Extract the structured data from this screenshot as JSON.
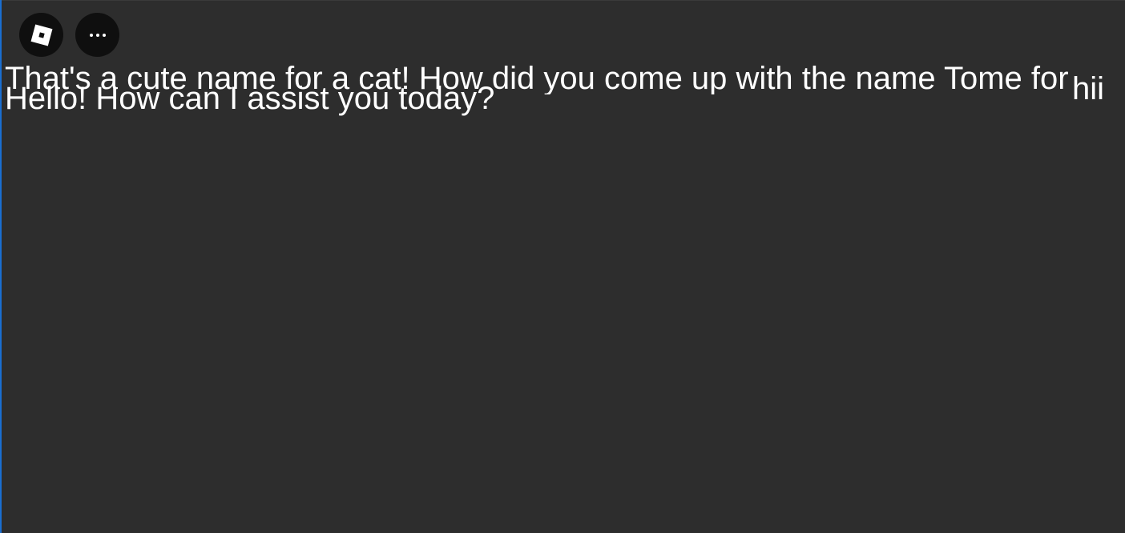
{
  "toolbar": {
    "menu_icon": "roblox-logo-icon",
    "more_icon": "more-dots-icon"
  },
  "chat": {
    "messages": [
      {
        "role": "bot",
        "text": "That's a cute name for a cat! How did you come up with the name Tome for"
      },
      {
        "role": "bot",
        "text": "Hello! How can I assist you today?"
      },
      {
        "role": "user",
        "text": "hii"
      }
    ]
  },
  "colors": {
    "background": "#2d2d2d",
    "button_bg": "#0f0f0f",
    "text": "#ffffff",
    "accent_border": "#1a6fd1"
  }
}
